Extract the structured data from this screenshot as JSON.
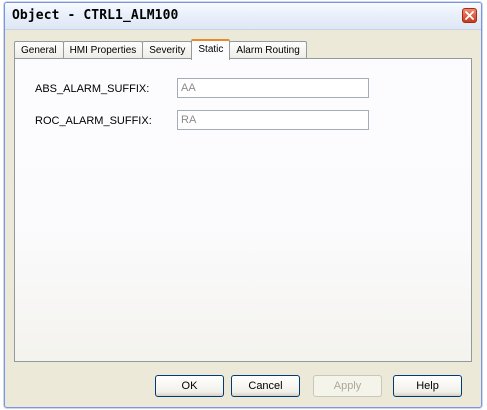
{
  "window": {
    "title": "Object - CTRL1_ALM100"
  },
  "tabs": [
    {
      "label": "General"
    },
    {
      "label": "HMI Properties"
    },
    {
      "label": "Severity"
    },
    {
      "label": "Static"
    },
    {
      "label": "Alarm Routing"
    }
  ],
  "active_tab": "Static",
  "fields": {
    "abs": {
      "label": "ABS_ALARM_SUFFIX:",
      "value": "AA"
    },
    "roc": {
      "label": "ROC_ALARM_SUFFIX:",
      "value": "RA"
    }
  },
  "buttons": {
    "ok": "OK",
    "cancel": "Cancel",
    "apply": "Apply",
    "help": "Help"
  },
  "colors": {
    "active_tab_accent": "#e68b2c",
    "close_button": "#c73b1d",
    "dialog_face": "#ece9d8"
  }
}
